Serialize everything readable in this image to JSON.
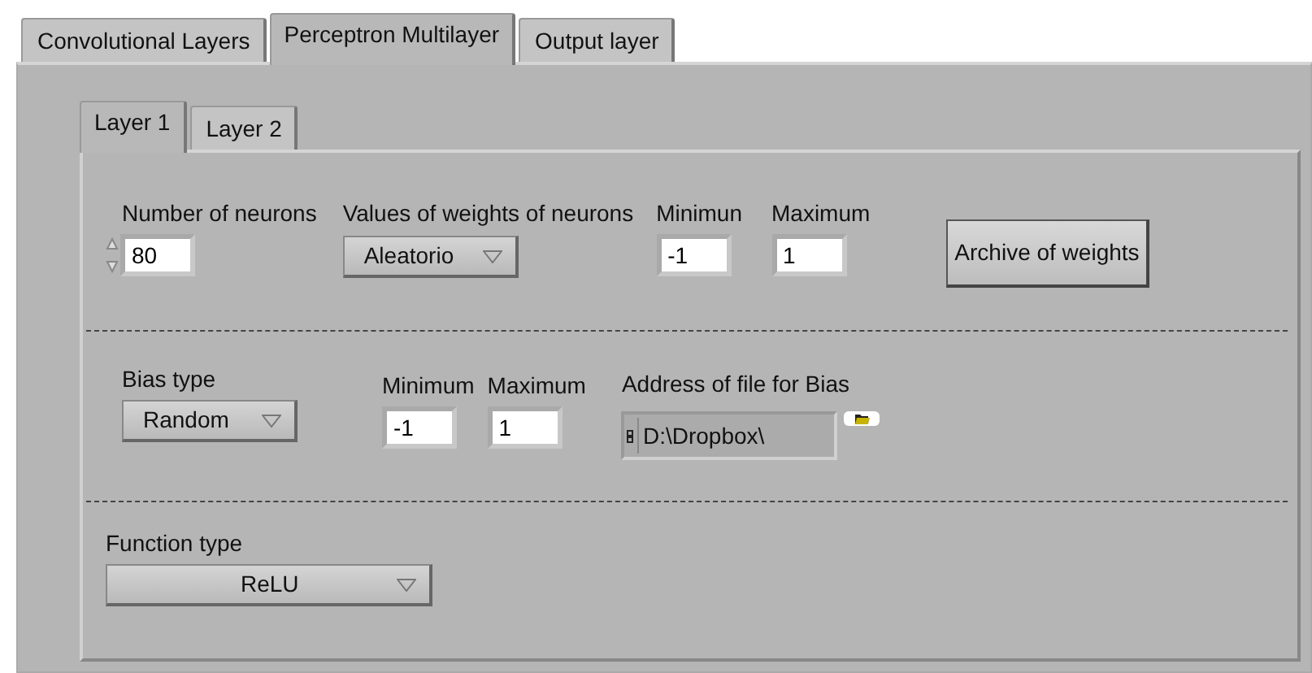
{
  "tabs": [
    {
      "label": "Convolutional Layers",
      "selected": false
    },
    {
      "label": "Perceptron Multilayer",
      "selected": true
    },
    {
      "label": "Output layer",
      "selected": false
    }
  ],
  "layer_tabs": [
    {
      "label": "Layer 1",
      "selected": true
    },
    {
      "label": "Layer 2",
      "selected": false
    }
  ],
  "weights": {
    "neurons_label": "Number of neurons",
    "neurons_value": "80",
    "values_label": "Values of weights of neurons",
    "values_choice": "Aleatorio",
    "min_label": "Minimun",
    "min_value": "-1",
    "max_label": "Maximum",
    "max_value": "1",
    "archive_button": "Archive of weights"
  },
  "bias": {
    "type_label": "Bias type",
    "type_choice": "Random",
    "min_label": "Minimum",
    "min_value": "-1",
    "max_label": "Maximum",
    "max_value": "1",
    "file_label": "Address of file for Bias",
    "file_value": "D:\\Dropbox\\"
  },
  "function": {
    "label": "Function type",
    "choice": "ReLU"
  }
}
